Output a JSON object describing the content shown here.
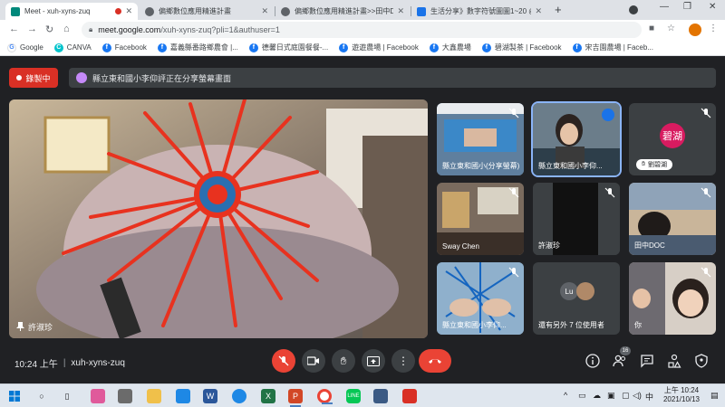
{
  "browser": {
    "tabs": [
      {
        "title": "Meet - xuh-xyns-zuq",
        "active": true,
        "color": "#00897b"
      },
      {
        "title": "偏鄉數位應用精進計畫",
        "active": false,
        "color": "#5f6368"
      },
      {
        "title": "偏鄉數位應用精進計畫>>田中DOC",
        "active": false,
        "color": "#5f6368"
      },
      {
        "title": "生活分享》數字符號圖圖1~20 @",
        "active": false,
        "color": "#1a73e8"
      }
    ],
    "new_tab": "+",
    "url_host": "meet.google.com",
    "url_path": "/xuh-xyns-zuq?pli=1&authuser=1",
    "bookmarks": [
      {
        "label": "Google",
        "icon": "g"
      },
      {
        "label": "CANVA",
        "icon": "c"
      },
      {
        "label": "Facebook",
        "icon": "fb"
      },
      {
        "label": "嘉義縣番路鄉農會 |...",
        "icon": "fb"
      },
      {
        "label": "德馨日式庭園餐餐-...",
        "icon": "fb"
      },
      {
        "label": "遊遊農場 | Facebook",
        "icon": "fb"
      },
      {
        "label": "大鑫農場",
        "icon": "fb"
      },
      {
        "label": "碧湖製茶 | Facebook",
        "icon": "fb"
      },
      {
        "label": "宋吉園農場 | Faceb...",
        "icon": "fb"
      }
    ]
  },
  "meet": {
    "recording_label": "錄製中",
    "share_banner": "縣立東和國小李仰評正在分享螢幕畫面",
    "main_speaker": "許淑珍",
    "tiles": [
      {
        "label": "縣立東和國小(分享螢幕)",
        "muted": true
      },
      {
        "label": "縣立東和國小李仰...",
        "muted": false,
        "speaking": true
      },
      {
        "label": "劉碧湖",
        "avatar": "碧湖",
        "muted": true
      },
      {
        "label": "Sway Chen",
        "muted": true
      },
      {
        "label": "許淑珍",
        "muted": true
      },
      {
        "label": "田中DOC",
        "muted": true
      },
      {
        "label": "縣立東和國小李仰...",
        "muted": true
      },
      {
        "label": "還有另外 7 位使用者",
        "avatar": "Lu"
      },
      {
        "label": "你",
        "muted": true
      }
    ],
    "time": "10:24 上午",
    "meeting_code": "xuh-xyns-zuq",
    "participants_count": "16"
  },
  "taskbar": {
    "input_indicator": "中",
    "clock_time": "上午 10:24",
    "clock_date": "2021/10/13"
  }
}
